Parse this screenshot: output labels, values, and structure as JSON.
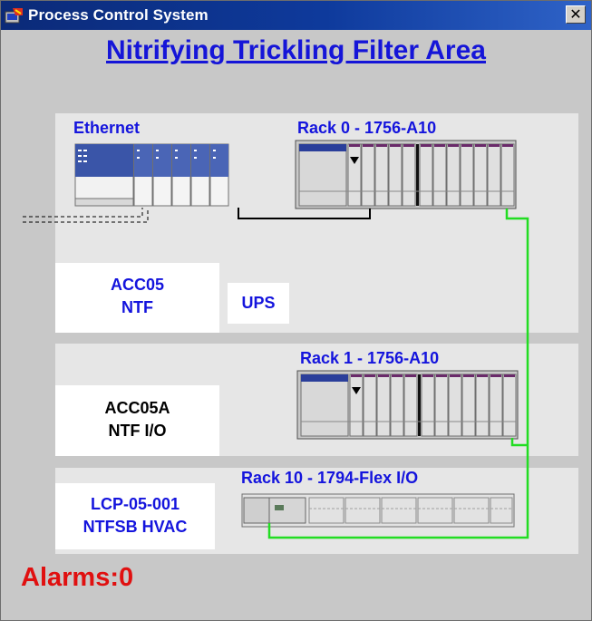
{
  "window": {
    "title": "Process Control System",
    "close_glyph": "✕"
  },
  "area_title": "Nitrifying Trickling Filter Area",
  "ethernet_label": "Ethernet",
  "racks": [
    {
      "label": "Rack 0 - 1756-A10"
    },
    {
      "label": "Rack 1 - 1756-A10"
    },
    {
      "label": "Rack 10 - 1794-Flex I/O"
    }
  ],
  "nodes": {
    "acc05": {
      "line1": "ACC05",
      "line2": "NTF"
    },
    "ups": {
      "label": "UPS"
    },
    "acc05a": {
      "line1": "ACC05A",
      "line2": "NTF I/O"
    },
    "lcp": {
      "line1": "LCP-05-001",
      "line2": "NTFSB HVAC"
    }
  },
  "alarms": {
    "label": "Alarms:",
    "count": "0"
  },
  "colors": {
    "title_blue": "#1414dd",
    "alarm_red": "#e01010",
    "link_green": "#22dd22"
  }
}
